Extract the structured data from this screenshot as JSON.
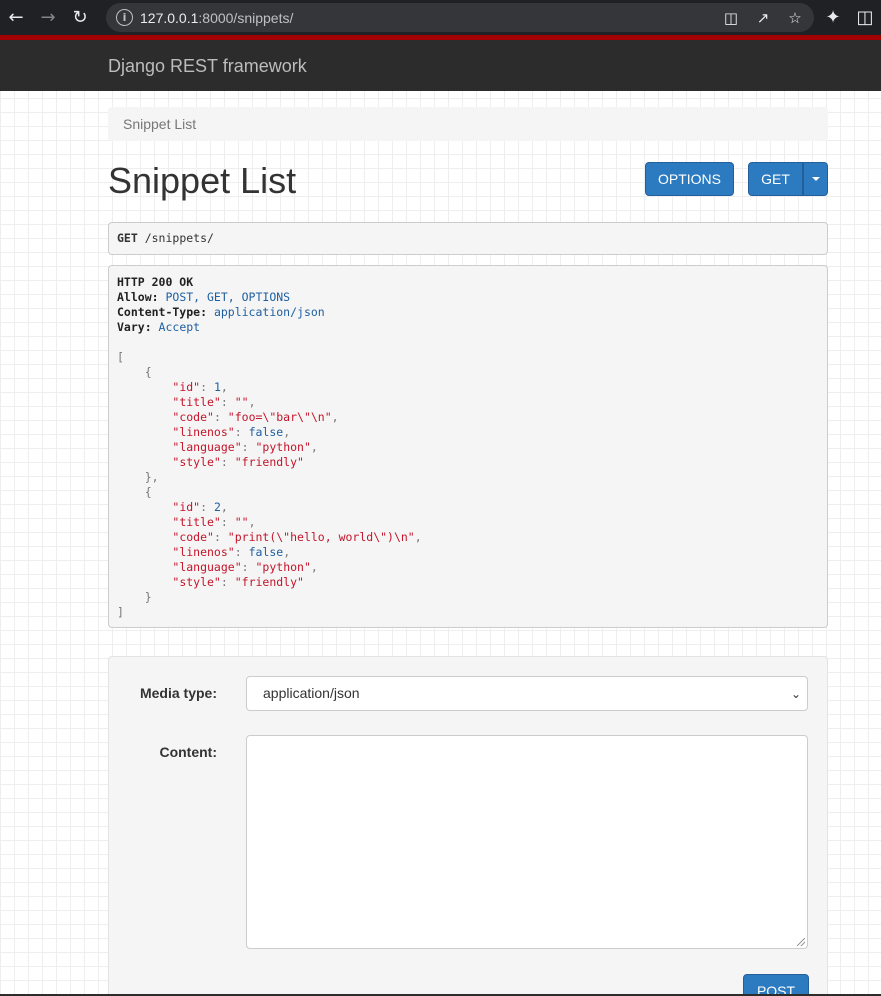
{
  "browser": {
    "url_host": "127.0.0.1",
    "url_rest": ":8000/snippets/",
    "icons": [
      "back-arrow-icon",
      "forward-arrow-icon",
      "reload-icon",
      "info-icon",
      "translate-icon",
      "share-icon",
      "star-icon",
      "extensions-icon",
      "sidebar-icon"
    ]
  },
  "navbar": {
    "brand": "Django REST framework"
  },
  "breadcrumb": {
    "label": "Snippet List"
  },
  "page": {
    "title": "Snippet List",
    "options_label": "OPTIONS",
    "get_label": "GET"
  },
  "request": {
    "method": "GET",
    "path": " /snippets/"
  },
  "response": {
    "status": "HTTP 200 OK",
    "headers": [
      {
        "name": "Allow:",
        "value": " POST, GET, OPTIONS"
      },
      {
        "name": "Content-Type:",
        "value": " application/json"
      },
      {
        "name": "Vary:",
        "value": " Accept"
      }
    ],
    "snippets": [
      {
        "id": 1,
        "title": "\"\"",
        "code": "\"foo=\\\"bar\\\"\\n\"",
        "linenos": "false",
        "language": "\"python\"",
        "style": "\"friendly\""
      },
      {
        "id": 2,
        "title": "\"\"",
        "code": "\"print(\\\"hello, world\\\")\\n\"",
        "linenos": "false",
        "language": "\"python\"",
        "style": "\"friendly\""
      }
    ]
  },
  "form": {
    "media_type_label": "Media type:",
    "media_type_value": "application/json",
    "content_label": "Content:",
    "content_value": "",
    "post_label": "POST"
  }
}
